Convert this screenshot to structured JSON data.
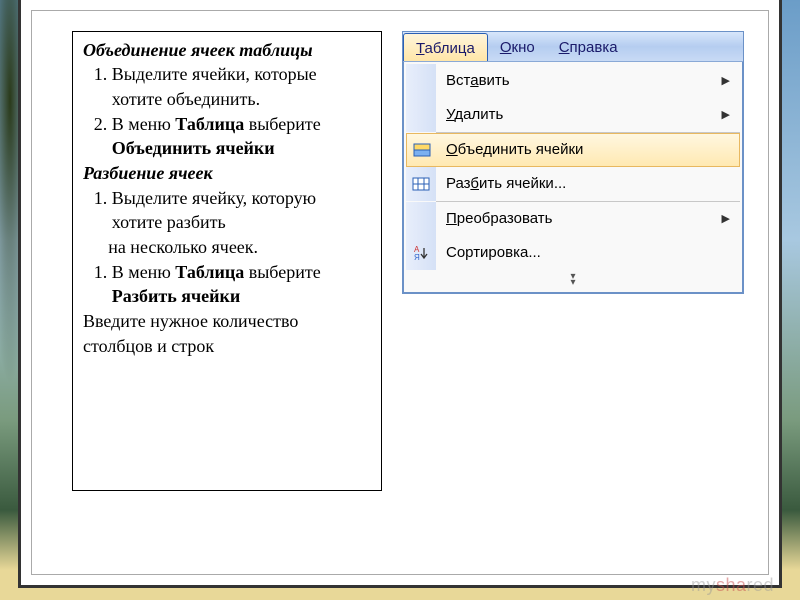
{
  "text": {
    "title": "Объединение ячеек таблицы",
    "merge_1": "Выделите ячейки, которые хотите объединить.",
    "merge_2_a": "В меню ",
    "merge_2_b": "Таблица",
    "merge_2_c": " выберите ",
    "merge_2_d": "Объединить ячейки",
    "subtitle": "Разбиение ячеек",
    "split_1": "Выделите ячейку, которую хотите разбить",
    "split_1_cont": " на несколько ячеек.",
    "split_2_a": "В меню ",
    "split_2_b": "Таблица",
    "split_2_c": " выберите ",
    "split_2_d": "Разбить ячейки",
    "footer": "Введите нужное количество столбцов и строк"
  },
  "menu": {
    "bar": {
      "table": "Таблица",
      "window": "Окно",
      "help": "Справка"
    },
    "items": {
      "insert": "Вставить",
      "delete": "Удалить",
      "merge": "Объединить ячейки",
      "split": "Разбить ячейки...",
      "convert": "Преобразовать",
      "sort": "Сортировка..."
    }
  },
  "watermark": "myshared"
}
